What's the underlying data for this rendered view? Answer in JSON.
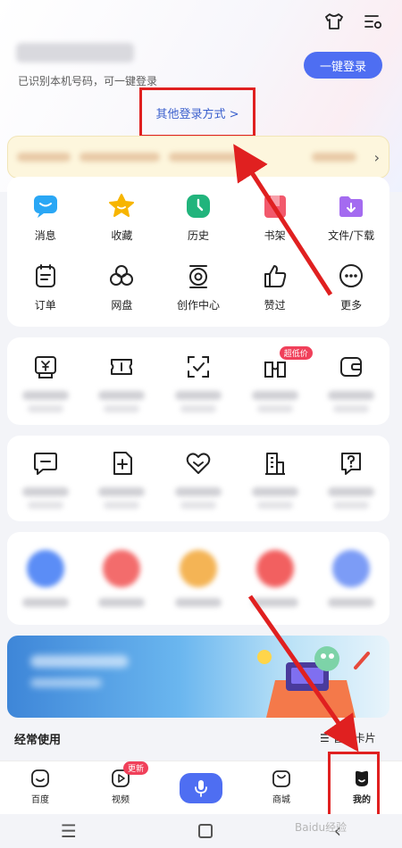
{
  "header": {
    "phone_hint": "已识别本机号码，可一键登录",
    "login_button": "一键登录",
    "other_login": "其他登录方式 >"
  },
  "quick_menu": {
    "row1": [
      {
        "label": "消息",
        "icon": "message-icon",
        "color": "#2aa7f5"
      },
      {
        "label": "收藏",
        "icon": "star-icon",
        "color": "#f7b500"
      },
      {
        "label": "历史",
        "icon": "clock-icon",
        "color": "#21b47c"
      },
      {
        "label": "书架",
        "icon": "bookshelf-icon",
        "color": "#f2596c"
      },
      {
        "label": "文件/下载",
        "icon": "folder-download-icon",
        "color": "#a46bf0"
      }
    ],
    "row2": [
      {
        "label": "订单",
        "icon": "order-icon"
      },
      {
        "label": "网盘",
        "icon": "cloud-drive-icon"
      },
      {
        "label": "创作中心",
        "icon": "creator-icon"
      },
      {
        "label": "赞过",
        "icon": "thumbs-up-icon"
      },
      {
        "label": "更多",
        "icon": "more-icon"
      }
    ]
  },
  "card2": {
    "badge": "超低价",
    "icons": [
      "yen-ticket-icon",
      "coupon-icon",
      "scan-check-icon",
      "shop-icon",
      "wallet-icon"
    ]
  },
  "card3": {
    "icons": [
      "comment-icon",
      "add-doc-icon",
      "heart-icon",
      "building-icon",
      "help-icon"
    ]
  },
  "card4": {
    "colors": [
      "#5b8df6",
      "#f36c6c",
      "#f4b455",
      "#f26060",
      "#7c9cf6"
    ]
  },
  "section": {
    "title": "经常使用",
    "manage": "管理卡片"
  },
  "tabbar": {
    "tabs": [
      {
        "label": "百度",
        "icon": "baidu-home-icon"
      },
      {
        "label": "视频",
        "icon": "video-icon",
        "badge": "更新"
      },
      {
        "label": "",
        "icon": "microphone-icon"
      },
      {
        "label": "商城",
        "icon": "mall-icon"
      },
      {
        "label": "我的",
        "icon": "profile-icon"
      }
    ]
  },
  "watermark": "Baidu经验"
}
